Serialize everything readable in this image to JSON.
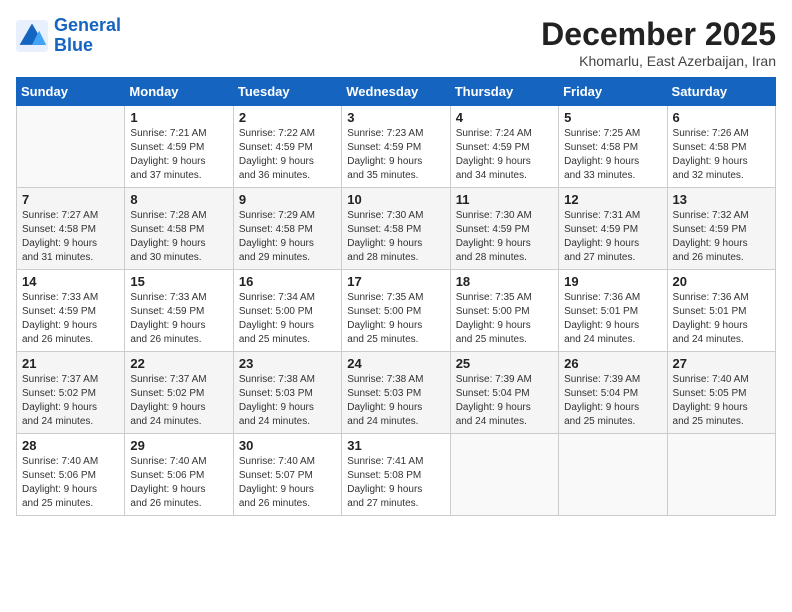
{
  "logo": {
    "line1": "General",
    "line2": "Blue"
  },
  "title": "December 2025",
  "subtitle": "Khomarlu, East Azerbaijan, Iran",
  "days_of_week": [
    "Sunday",
    "Monday",
    "Tuesday",
    "Wednesday",
    "Thursday",
    "Friday",
    "Saturday"
  ],
  "weeks": [
    [
      {
        "num": "",
        "info": ""
      },
      {
        "num": "1",
        "info": "Sunrise: 7:21 AM\nSunset: 4:59 PM\nDaylight: 9 hours\nand 37 minutes."
      },
      {
        "num": "2",
        "info": "Sunrise: 7:22 AM\nSunset: 4:59 PM\nDaylight: 9 hours\nand 36 minutes."
      },
      {
        "num": "3",
        "info": "Sunrise: 7:23 AM\nSunset: 4:59 PM\nDaylight: 9 hours\nand 35 minutes."
      },
      {
        "num": "4",
        "info": "Sunrise: 7:24 AM\nSunset: 4:59 PM\nDaylight: 9 hours\nand 34 minutes."
      },
      {
        "num": "5",
        "info": "Sunrise: 7:25 AM\nSunset: 4:58 PM\nDaylight: 9 hours\nand 33 minutes."
      },
      {
        "num": "6",
        "info": "Sunrise: 7:26 AM\nSunset: 4:58 PM\nDaylight: 9 hours\nand 32 minutes."
      }
    ],
    [
      {
        "num": "7",
        "info": "Sunrise: 7:27 AM\nSunset: 4:58 PM\nDaylight: 9 hours\nand 31 minutes."
      },
      {
        "num": "8",
        "info": "Sunrise: 7:28 AM\nSunset: 4:58 PM\nDaylight: 9 hours\nand 30 minutes."
      },
      {
        "num": "9",
        "info": "Sunrise: 7:29 AM\nSunset: 4:58 PM\nDaylight: 9 hours\nand 29 minutes."
      },
      {
        "num": "10",
        "info": "Sunrise: 7:30 AM\nSunset: 4:58 PM\nDaylight: 9 hours\nand 28 minutes."
      },
      {
        "num": "11",
        "info": "Sunrise: 7:30 AM\nSunset: 4:59 PM\nDaylight: 9 hours\nand 28 minutes."
      },
      {
        "num": "12",
        "info": "Sunrise: 7:31 AM\nSunset: 4:59 PM\nDaylight: 9 hours\nand 27 minutes."
      },
      {
        "num": "13",
        "info": "Sunrise: 7:32 AM\nSunset: 4:59 PM\nDaylight: 9 hours\nand 26 minutes."
      }
    ],
    [
      {
        "num": "14",
        "info": "Sunrise: 7:33 AM\nSunset: 4:59 PM\nDaylight: 9 hours\nand 26 minutes."
      },
      {
        "num": "15",
        "info": "Sunrise: 7:33 AM\nSunset: 4:59 PM\nDaylight: 9 hours\nand 26 minutes."
      },
      {
        "num": "16",
        "info": "Sunrise: 7:34 AM\nSunset: 5:00 PM\nDaylight: 9 hours\nand 25 minutes."
      },
      {
        "num": "17",
        "info": "Sunrise: 7:35 AM\nSunset: 5:00 PM\nDaylight: 9 hours\nand 25 minutes."
      },
      {
        "num": "18",
        "info": "Sunrise: 7:35 AM\nSunset: 5:00 PM\nDaylight: 9 hours\nand 25 minutes."
      },
      {
        "num": "19",
        "info": "Sunrise: 7:36 AM\nSunset: 5:01 PM\nDaylight: 9 hours\nand 24 minutes."
      },
      {
        "num": "20",
        "info": "Sunrise: 7:36 AM\nSunset: 5:01 PM\nDaylight: 9 hours\nand 24 minutes."
      }
    ],
    [
      {
        "num": "21",
        "info": "Sunrise: 7:37 AM\nSunset: 5:02 PM\nDaylight: 9 hours\nand 24 minutes."
      },
      {
        "num": "22",
        "info": "Sunrise: 7:37 AM\nSunset: 5:02 PM\nDaylight: 9 hours\nand 24 minutes."
      },
      {
        "num": "23",
        "info": "Sunrise: 7:38 AM\nSunset: 5:03 PM\nDaylight: 9 hours\nand 24 minutes."
      },
      {
        "num": "24",
        "info": "Sunrise: 7:38 AM\nSunset: 5:03 PM\nDaylight: 9 hours\nand 24 minutes."
      },
      {
        "num": "25",
        "info": "Sunrise: 7:39 AM\nSunset: 5:04 PM\nDaylight: 9 hours\nand 24 minutes."
      },
      {
        "num": "26",
        "info": "Sunrise: 7:39 AM\nSunset: 5:04 PM\nDaylight: 9 hours\nand 25 minutes."
      },
      {
        "num": "27",
        "info": "Sunrise: 7:40 AM\nSunset: 5:05 PM\nDaylight: 9 hours\nand 25 minutes."
      }
    ],
    [
      {
        "num": "28",
        "info": "Sunrise: 7:40 AM\nSunset: 5:06 PM\nDaylight: 9 hours\nand 25 minutes."
      },
      {
        "num": "29",
        "info": "Sunrise: 7:40 AM\nSunset: 5:06 PM\nDaylight: 9 hours\nand 26 minutes."
      },
      {
        "num": "30",
        "info": "Sunrise: 7:40 AM\nSunset: 5:07 PM\nDaylight: 9 hours\nand 26 minutes."
      },
      {
        "num": "31",
        "info": "Sunrise: 7:41 AM\nSunset: 5:08 PM\nDaylight: 9 hours\nand 27 minutes."
      },
      {
        "num": "",
        "info": ""
      },
      {
        "num": "",
        "info": ""
      },
      {
        "num": "",
        "info": ""
      }
    ]
  ]
}
